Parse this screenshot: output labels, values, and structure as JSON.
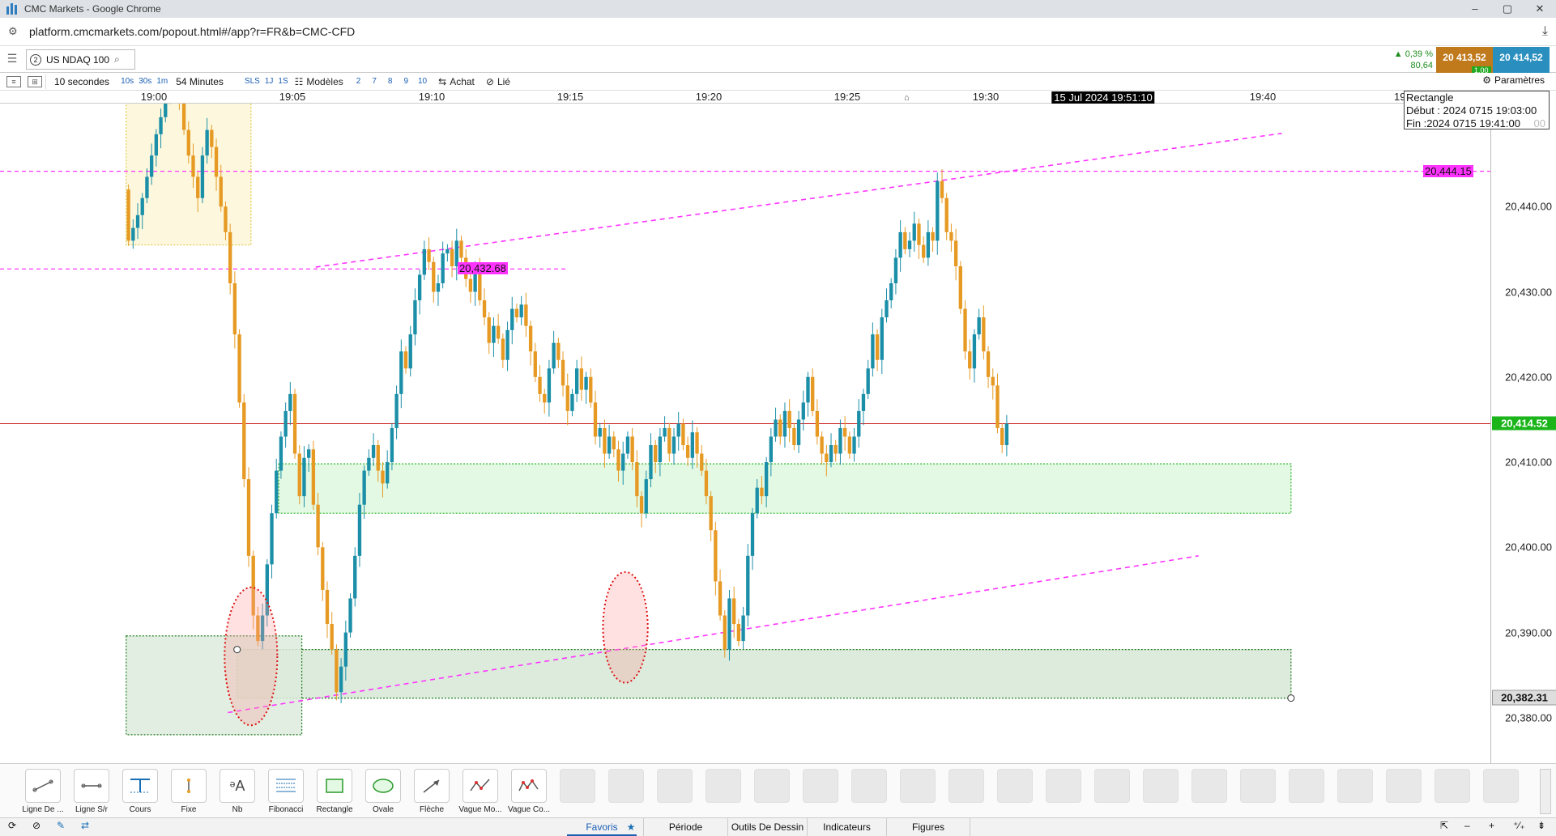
{
  "window": {
    "title": "CMC Markets - Google Chrome",
    "controls": [
      "–",
      "▢",
      "✕"
    ]
  },
  "address": {
    "url": "platform.cmcmarkets.com/popout.html#/app?r=FR&b=CMC-CFD"
  },
  "header": {
    "instrument_badge": "2",
    "instrument": "US NDAQ 100",
    "change_pct": "▲ 0,39 %",
    "change_pts": "80,64",
    "sell_price": "20 413,52",
    "buy_price": "20 414,52",
    "spread": "1,00"
  },
  "toolbar": {
    "interval": "10 secondes",
    "timeframes": [
      "10s",
      "30s",
      "1m"
    ],
    "range": "54 Minutes",
    "quick": [
      "SLS",
      "1J",
      "1S"
    ],
    "models": "Modèles",
    "numbers": [
      "2",
      "7",
      "8",
      "9",
      "10"
    ],
    "achat": "Achat",
    "lie": "Lié",
    "params": "Paramètres"
  },
  "info_box": {
    "title": "Rectangle",
    "start": "Début : 2024 0715 19:03:00",
    "end": "Fin :2024 0715 19:41:00",
    "ghost": "00"
  },
  "cursor_time": "15 Jul 2024 19:51:10",
  "colors": {
    "up": "#1b8fa8",
    "down": "#e69a23",
    "magenta": "#ff33ff",
    "current_line": "#cc2222",
    "zone_green": "#e3f9e3",
    "zone_dark": "#dcebdc",
    "zone_yellow": "#fdf8dd"
  },
  "chart_data": {
    "type": "candlestick",
    "instrument": "US NDAQ 100",
    "interval": "10 seconds",
    "x_ticks": [
      "19:00",
      "19:05",
      "19:10",
      "19:15",
      "19:20",
      "19:25",
      "19:30",
      "19:40",
      "19:"
    ],
    "y_ticks": [
      "20,380.00",
      "20,390.00",
      "20,400.00",
      "20,410.00",
      "20,420.00",
      "20,430.00",
      "20,440.00"
    ],
    "ylim": [
      20376.2,
      20455.3
    ],
    "current_price": 20414.52,
    "current_price_label": "20,414.52",
    "marker_price": 20382.31,
    "marker_price_label": "20,382.31",
    "levels": [
      {
        "label": "20,444.15",
        "value": 20444.15
      },
      {
        "label": "20,432.68",
        "value": 20432.68
      }
    ],
    "zones": [
      {
        "from": "18:59:00",
        "to": "19:03:30",
        "low": 20435.5,
        "high": 20455.3
      },
      {
        "from": "19:04:30",
        "to": "19:41:00",
        "low": 20404.0,
        "high": 20409.8
      },
      {
        "from": "19:03:00",
        "to": "19:41:00",
        "low": 20382.3,
        "high": 20388.0
      },
      {
        "from": "18:59:00",
        "to": "19:05:20",
        "low": 20378.0,
        "high": 20389.6
      }
    ],
    "trendlines": [
      {
        "t1": "19:05:50",
        "v1": 20432.9,
        "t2": "19:40:40",
        "v2": 20448.6
      },
      {
        "t1": "19:02:40",
        "v1": 20380.6,
        "t2": "19:37:40",
        "v2": 20399.0
      }
    ],
    "ellipses": [
      {
        "t": "19:03:30",
        "v": 20387.2,
        "dt_sec": 100,
        "dv": 8.1
      },
      {
        "t": "19:17:00",
        "v": 20390.6,
        "dt_sec": 85,
        "dv": 6.5
      }
    ],
    "candles_10s": {
      "start": "18:59:00",
      "open": 20442.0,
      "closes": [
        20436.0,
        20437.5,
        20439.0,
        20441.0,
        20443.5,
        20446.0,
        20448.5,
        20450.5,
        20453.0,
        20454.5,
        20455.3,
        20453.0,
        20449.0,
        20446.0,
        20443.5,
        20441.0,
        20446.0,
        20449.0,
        20447.0,
        20443.5,
        20440.0,
        20437.0,
        20431.0,
        20425.0,
        20417.0,
        20408.0,
        20399.0,
        20392.0,
        20389.0,
        20392.0,
        20398.0,
        20404.0,
        20409.0,
        20413.0,
        20416.0,
        20418.0,
        20411.0,
        20406.0,
        20410.5,
        20411.5,
        20405.0,
        20400.0,
        20395.0,
        20391.0,
        20388.0,
        20383.0,
        20386.0,
        20390.0,
        20394.0,
        20399.0,
        20405.0,
        20409.0,
        20410.5,
        20412.0,
        20409.0,
        20407.5,
        20410.0,
        20414.0,
        20418.0,
        20423.0,
        20421.0,
        20425.0,
        20429.0,
        20432.0,
        20435.0,
        20433.5,
        20430.0,
        20431.0,
        20434.5,
        20435.0,
        20433.0,
        20436.0,
        20434.0,
        20431.5,
        20430.0,
        20433.0,
        20429.0,
        20427.0,
        20424.0,
        20426.0,
        20424.5,
        20422.0,
        20425.5,
        20428.0,
        20427.0,
        20428.5,
        20426.0,
        20423.0,
        20420.0,
        20418.0,
        20417.0,
        20421.0,
        20424.0,
        20422.0,
        20419.0,
        20416.0,
        20418.0,
        20421.0,
        20418.5,
        20420.0,
        20417.0,
        20413.0,
        20414.0,
        20411.0,
        20413.0,
        20411.5,
        20409.0,
        20411.0,
        20413.0,
        20410.0,
        20406.0,
        20404.0,
        20408.0,
        20412.0,
        20410.0,
        20413.0,
        20414.0,
        20411.0,
        20413.0,
        20414.5,
        20412.0,
        20410.5,
        20413.5,
        20411.0,
        20409.0,
        20406.0,
        20402.0,
        20396.0,
        20392.0,
        20388.0,
        20394.0,
        20391.0,
        20389.0,
        20392.0,
        20399.0,
        20404.0,
        20407.0,
        20406.0,
        20410.0,
        20413.0,
        20415.0,
        20413.0,
        20416.0,
        20414.0,
        20412.0,
        20415.0,
        20417.0,
        20420.0,
        20416.0,
        20413.0,
        20411.0,
        20410.0,
        20412.0,
        20411.0,
        20414.0,
        20413.0,
        20411.0,
        20413.0,
        20416.0,
        20418.0,
        20421.0,
        20425.0,
        20422.0,
        20427.0,
        20429.0,
        20431.0,
        20434.0,
        20437.0,
        20435.0,
        20436.0,
        20438.0,
        20435.5,
        20434.0,
        20437.0,
        20436.0,
        20443.0,
        20441.0,
        20437.0,
        20436.0,
        20433.0,
        20428.0,
        20423.0,
        20421.0,
        20425.0,
        20427.0,
        20423.0,
        20420.0,
        20419.0,
        20414.0,
        20412.0,
        20414.52
      ]
    }
  },
  "drawing_tools": [
    "Ligne De ...",
    "Ligne S/r",
    "Cours",
    "Fixe",
    "Nb",
    "Fibonacci",
    "Rectangle",
    "Ovale",
    "Flèche",
    "Vague Mo...",
    "Vague Co..."
  ],
  "bottom_tabs": {
    "favoris": "Favoris",
    "periode": "Période",
    "outils": "Outils De Dessin",
    "indicateurs": "Indicateurs",
    "figures": "Figures"
  },
  "bottom_icons": [
    "⟳",
    "⊘",
    "✎",
    "⇄"
  ],
  "bottom_right_icons": [
    "⇱",
    "–",
    "+",
    "⁺⁄₊",
    "⇟"
  ]
}
